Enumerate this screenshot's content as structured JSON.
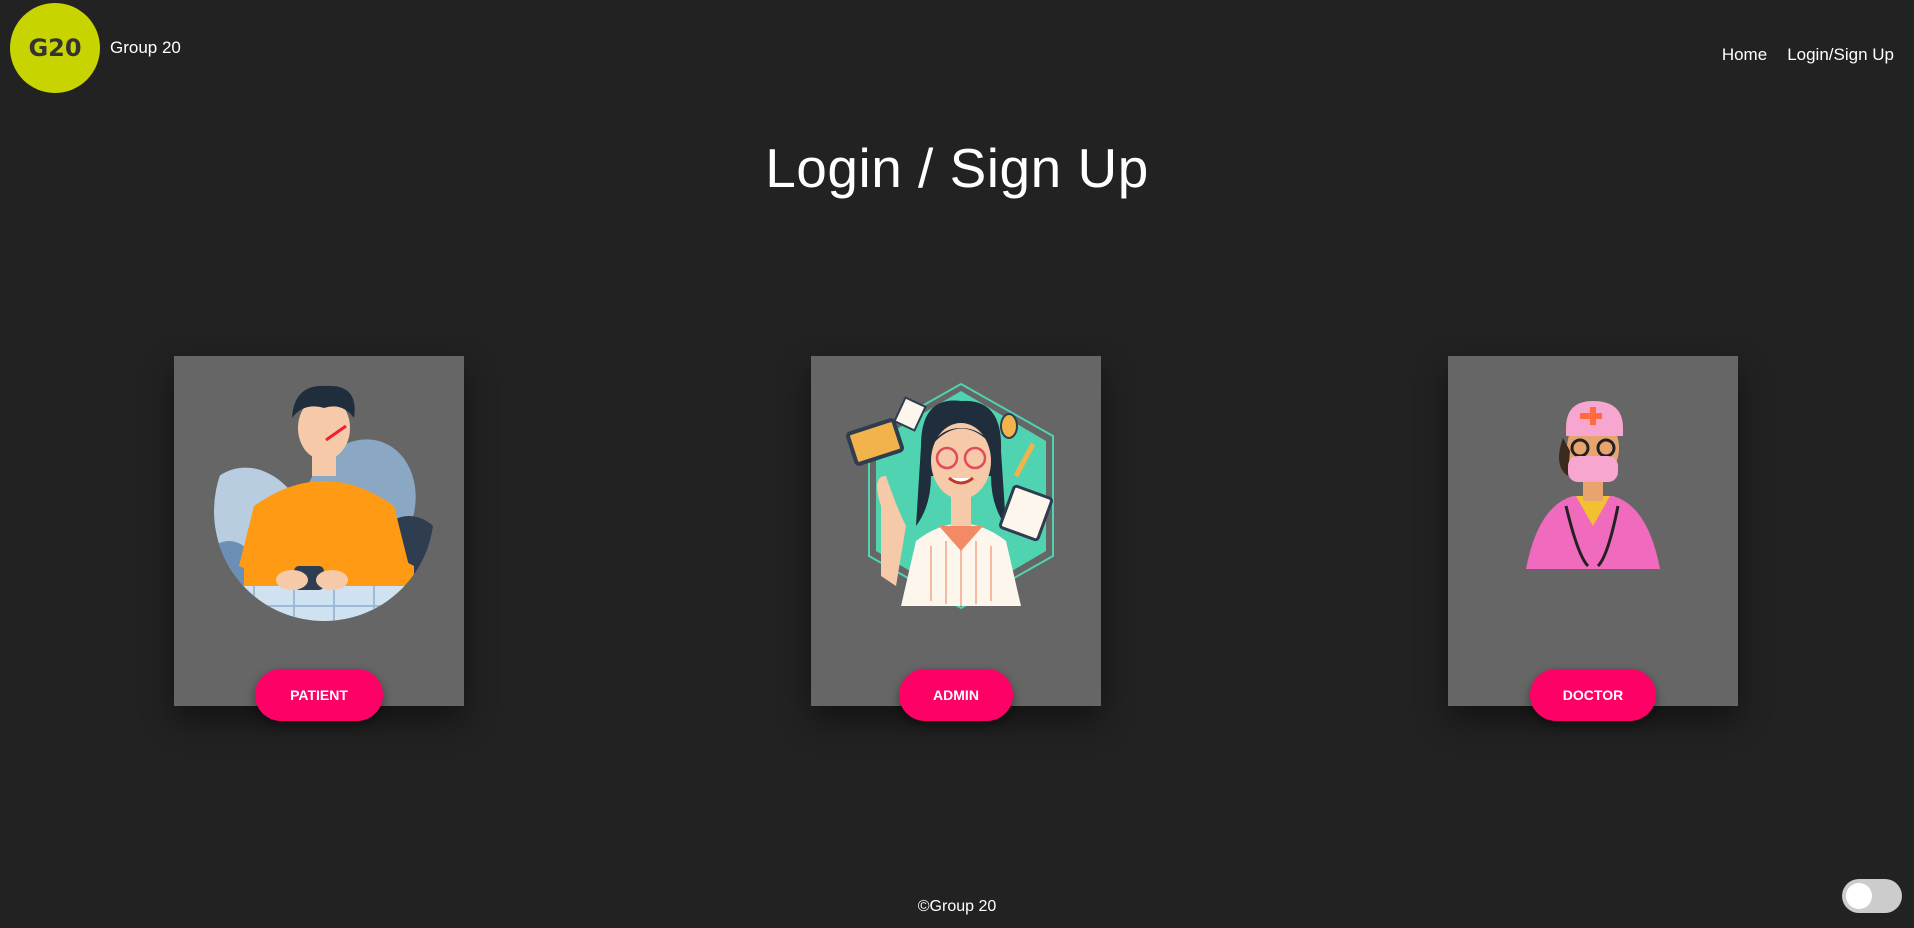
{
  "header": {
    "logo_text": "G20",
    "brand": "Group 20",
    "nav": [
      {
        "label": "Home"
      },
      {
        "label": "Login/Sign Up"
      }
    ]
  },
  "main": {
    "title": "Login / Sign Up",
    "cards": [
      {
        "illustration": "sick-patient-illustration",
        "button_label": "PATIENT"
      },
      {
        "illustration": "admin-woman-illustration",
        "button_label": "ADMIN"
      },
      {
        "illustration": "doctor-illustration",
        "button_label": "DOCTOR"
      }
    ]
  },
  "footer": {
    "text": "©Group 20"
  },
  "theme_toggle": {
    "checked": false
  },
  "colors": {
    "background": "#222222",
    "card": "#666666",
    "accent": "#ff0066",
    "logo": "#c8d400"
  }
}
